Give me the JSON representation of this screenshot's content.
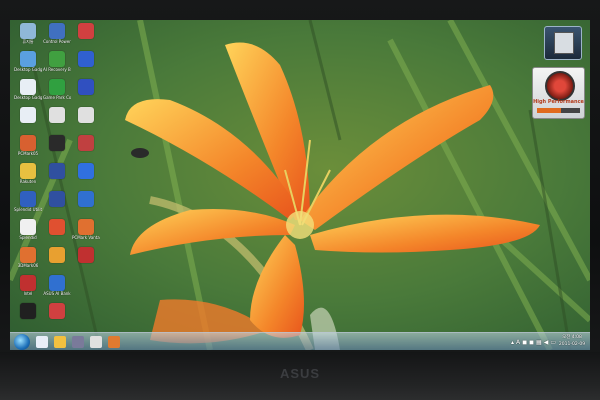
{
  "desktop": {
    "icons": [
      {
        "label": "휴지통",
        "color": "#8fb8d8"
      },
      {
        "label": "Desktop Gadget Gallery",
        "color": "#5aa0e0"
      },
      {
        "label": "Desktop Gadgets",
        "color": "#e8eef5"
      },
      {
        "label": "",
        "color": "#e8eef5"
      },
      {
        "label": "PCMark05",
        "color": "#d86030"
      },
      {
        "label": "Rakuten",
        "color": "#e8c040"
      },
      {
        "label": "Splendid Utility",
        "color": "#3060c0"
      },
      {
        "label": "Splendid",
        "color": "#f0f0f0"
      },
      {
        "label": "3DMark06",
        "color": "#e07030"
      },
      {
        "label": "Intel",
        "color": "#c03030"
      },
      {
        "label": "",
        "color": "#202020"
      },
      {
        "label": "Control Power",
        "color": "#4070c0"
      },
      {
        "label": "AI Recovery Burner",
        "color": "#40a040"
      },
      {
        "label": "Game Park Console",
        "color": "#30a040"
      },
      {
        "label": "",
        "color": "#e0e0e0"
      },
      {
        "label": "",
        "color": "#2a2a2a"
      },
      {
        "label": "",
        "color": "#3050a0"
      },
      {
        "label": "",
        "color": "#3050a0"
      },
      {
        "label": "",
        "color": "#e05030"
      },
      {
        "label": "",
        "color": "#e8a030"
      },
      {
        "label": "ASUS AI Bank",
        "color": "#3070d0"
      },
      {
        "label": "",
        "color": "#d04040"
      },
      {
        "label": "",
        "color": "#d04040"
      },
      {
        "label": "",
        "color": "#3060d0"
      },
      {
        "label": "",
        "color": "#3050c0"
      },
      {
        "label": "",
        "color": "#e0e0e0"
      },
      {
        "label": "",
        "color": "#c04040"
      },
      {
        "label": "",
        "color": "#3070e0"
      },
      {
        "label": "",
        "color": "#3070d0"
      },
      {
        "label": "PCMark Vantage",
        "color": "#e07030"
      },
      {
        "label": "",
        "color": "#c03030"
      }
    ]
  },
  "gadgets": {
    "performance_label": "High Performance",
    "performance_level": 0.55
  },
  "clock": {
    "time": "오전 4:08",
    "date": "2011-02-09"
  },
  "tray_language": "A",
  "brand": "ASUS"
}
